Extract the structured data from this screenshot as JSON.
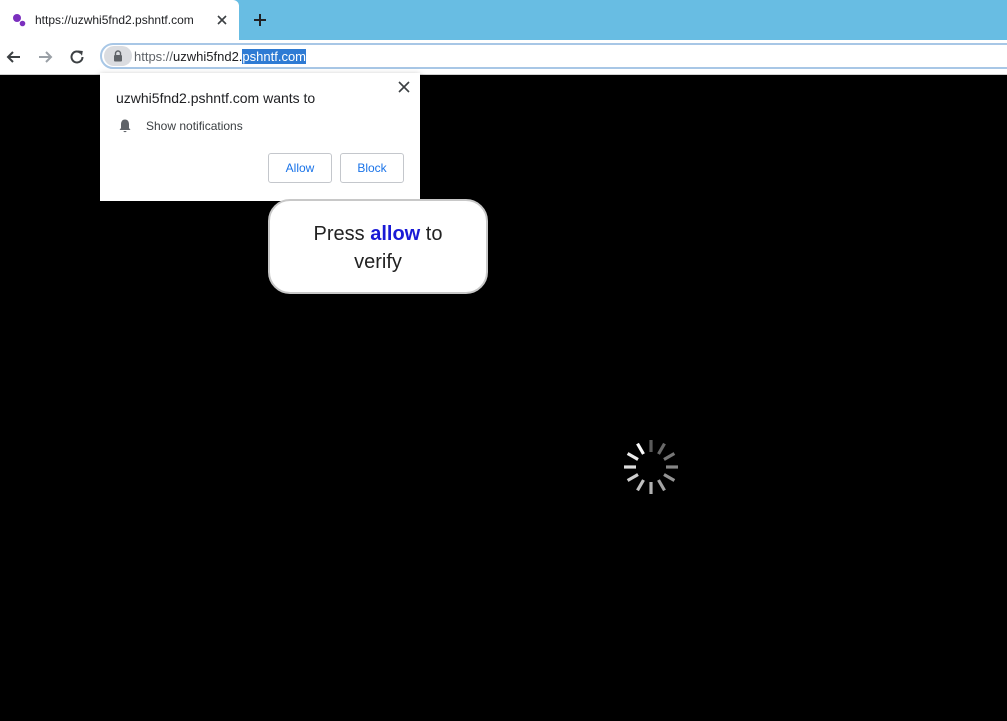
{
  "tab": {
    "title": "https://uzwhi5fnd2.pshntf.com",
    "favicon": "site-favicon-icon",
    "close_icon": "close-icon"
  },
  "toolbar": {
    "new_tab_icon": "plus-icon",
    "back_icon": "arrow-left-icon",
    "forward_icon": "arrow-right-icon",
    "reload_icon": "reload-icon",
    "lock_icon": "lock-icon"
  },
  "address": {
    "scheme": "https://",
    "host_prefix": "uzwhi5fnd2.",
    "host_selected": "pshntf.com"
  },
  "popup": {
    "title": "uzwhi5fnd2.pshntf.com wants to",
    "permission": "Show notifications",
    "allow_label": "Allow",
    "block_label": "Block"
  },
  "page": {
    "line1_pre": "Press ",
    "line1_highlight": "allow",
    "line1_post": " to",
    "line2": "verify"
  },
  "colors": {
    "tabstrip": "#68bde3",
    "page_background": "#000000",
    "accent": "#1a73e8",
    "highlight_text": "#1a1ad6",
    "selection": "#2e7bd4"
  }
}
